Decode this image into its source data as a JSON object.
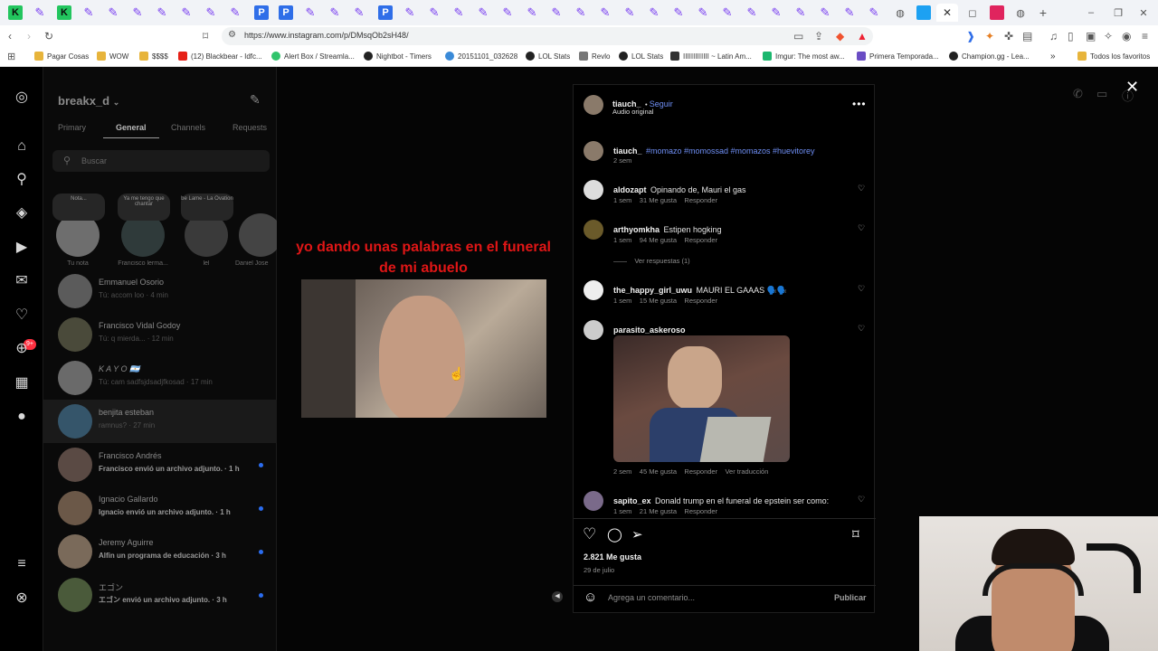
{
  "browser": {
    "url": "https://www.instagram.com/p/DMsqOb2sH48/",
    "bookmarks": [
      "Pagar Cosas",
      "WOW",
      "$$$$",
      "(12) Blackbear - Idfc...",
      "Alert Box / Streamla...",
      "Nightbot - Timers",
      "20151101_032628",
      "LOL Stats",
      "Revlo",
      "LOL Stats",
      "IIIIIIIIIIIII ~ Latin Am...",
      "Imgur: The most aw...",
      "Primera Temporada...",
      "Champion.gg - Lea...",
      "Todos los favoritos"
    ]
  },
  "dm": {
    "username": "breakx_d",
    "tabs": [
      "Primary",
      "General",
      "Channels",
      "Requests"
    ],
    "active_tab": "General",
    "search_placeholder": "Buscar",
    "stories": [
      {
        "bubble": "Nota...",
        "name": "Tu nota"
      },
      {
        "bubble": "Ya me tengo que chantar",
        "name": "Francisco lerma..."
      },
      {
        "bubble": "be Lame - La Ovation",
        "name": "lel"
      },
      {
        "bubble": "",
        "name": "Daniel Jose"
      }
    ],
    "conversations": [
      {
        "name": "Emmanuel Osorio",
        "last": "Tú: accom loo · 4 min",
        "unread": false
      },
      {
        "name": "Francisco Vidal Godoy",
        "last": "Tú: q mierda... · 12 min",
        "unread": false
      },
      {
        "name": "K A Y O 🇦🇷",
        "last": "Tú: cam sadfsjdsadjfkosad · 17 min",
        "unread": false
      },
      {
        "name": "benjita esteban",
        "last": "ramnus? · 27 min",
        "unread": false
      },
      {
        "name": "Francisco Andrés",
        "last": "Francisco envió un archivo adjunto. · 1 h",
        "unread": true
      },
      {
        "name": "Ignacio Gallardo",
        "last": "Ignacio envió un archivo adjunto. · 1 h",
        "unread": true
      },
      {
        "name": "Jeremy Aguirre",
        "last": "Alfin un programa de educación · 3 h",
        "unread": true
      },
      {
        "name": "エゴン",
        "last": "エゴン envió un archivo adjunto. · 3 h",
        "unread": true
      }
    ]
  },
  "video": {
    "caption": "yo dando unas palabras en el funeral de mi abuelo"
  },
  "post": {
    "author": "tiauch_",
    "follow": "Seguir",
    "audio": "Audio original",
    "caption_author": "tiauch_",
    "caption_tags": "#momazo #momossad #momazos #huevitorey",
    "caption_time": "2 sem",
    "comments": [
      {
        "user": "aldozapt",
        "text": "Opinando de, Mauri el gas",
        "time": "1 sem",
        "likes": "31 Me gusta",
        "reply": "Responder"
      },
      {
        "user": "arthyomkha",
        "text": "Estipen hogking",
        "time": "1 sem",
        "likes": "94 Me gusta",
        "reply": "Responder",
        "see_replies": "Ver respuestas (1)"
      },
      {
        "user": "the_happy_girl_uwu",
        "text": "MAURI EL GAAAS 🗣️🗣️",
        "time": "1 sem",
        "likes": "15 Me gusta",
        "reply": "Responder"
      },
      {
        "user": "parasito_askeroso",
        "text": "",
        "time": "2 sem",
        "likes": "45 Me gusta",
        "reply": "Responder",
        "translate": "Ver traducción"
      },
      {
        "user": "sapito_ex",
        "text": "Donald trump en el funeral de epstein ser como:",
        "time": "1 sem",
        "likes": "21 Me gusta",
        "reply": "Responder"
      }
    ],
    "likes": "2.821 Me gusta",
    "date": "29 de julio",
    "comment_placeholder": "Agrega un comentario...",
    "publish": "Publicar"
  },
  "colors": {
    "accent_blue": "#6f8ff5",
    "caption_red": "#e01616",
    "badge_red": "#ff3040"
  }
}
